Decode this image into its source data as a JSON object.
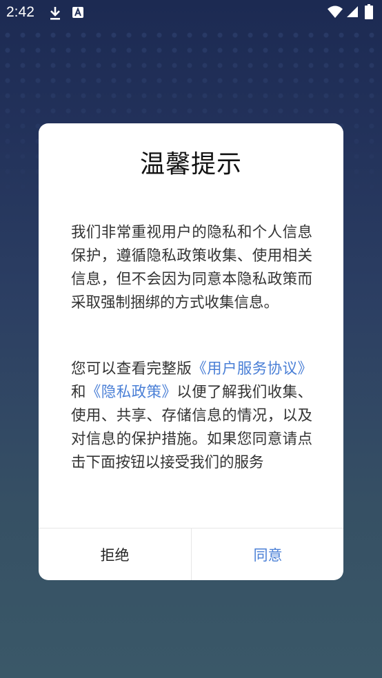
{
  "status_bar": {
    "time": "2:42",
    "icons": [
      "download-icon",
      "font-a-icon",
      "wifi-icon",
      "signal-icon",
      "battery-icon"
    ]
  },
  "dialog": {
    "title": "温馨提示",
    "paragraph1": "我们非常重视用户的隐私和个人信息保护，遵循隐私政策收集、使用相关信息，但不会因为同意本隐私政策而采取强制捆绑的方式收集信息。",
    "paragraph2": {
      "prefix": "您可以查看完整版",
      "link_user_agreement": "《用户服务协议》",
      "and": "和",
      "link_privacy_policy": "《隐私政策》",
      "suffix": "以便了解我们收集、使用、共享、存储信息的情况，以及对信息的保护措施。如果您同意请点击下面按钮以接受我们的服务"
    },
    "reject_label": "拒绝",
    "agree_label": "同意"
  },
  "colors": {
    "link": "#4a7fd6",
    "background_top": "#1c2a52",
    "background_bottom": "#3a5868"
  }
}
